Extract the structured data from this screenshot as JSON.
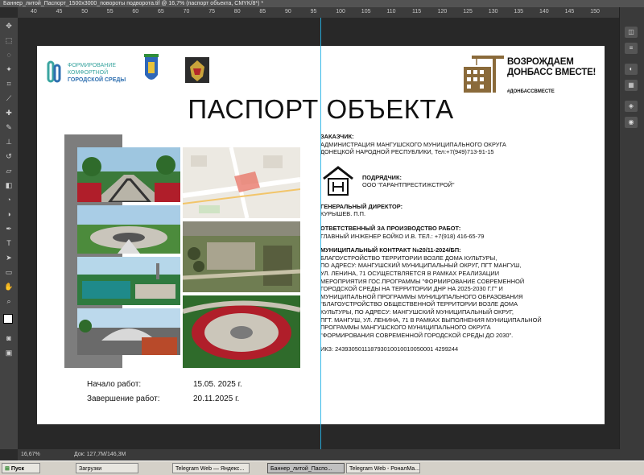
{
  "window": {
    "title": "Баннер_литой_Паспорт_1500х3000_повороты подворота.tif @ 16,7% (паспорт объекта, CMYK/8*) *"
  },
  "ruler": {
    "ticks": [
      "40",
      "45",
      "50",
      "55",
      "60",
      "65",
      "70",
      "75",
      "80",
      "85",
      "90",
      "95",
      "100",
      "105",
      "110",
      "115",
      "120",
      "125",
      "130",
      "135",
      "140",
      "145",
      "150"
    ]
  },
  "status": {
    "zoom": "16,67%",
    "doc": "Док: 127,7M/146,3M"
  },
  "taskbar": {
    "start": "Пуск",
    "tasks": [
      "Загрузки",
      "Telegram Web — Яндекс...",
      "Баннер_литой_Паспо...",
      "Telegram Web - РоналМа..."
    ]
  },
  "doc": {
    "fks_logo": {
      "line1": "ФОРМИРОВАНИЕ",
      "line2": "КОМФОРТНОЙ",
      "line3": "ГОРОДСКОЙ СРЕДЫ"
    },
    "banner": {
      "line1": "ВОЗРОЖДАЕМ",
      "line2": "ДОНБАСС ВМЕСТЕ!",
      "hashtag": "#ДОНБАССВМЕСТЕ"
    },
    "title": "ПАСПОРТ ОБЪЕКТА",
    "customer": {
      "heading": "ЗАКАЗЧИК:",
      "line1": "АДМИНИСТРАЦИЯ МАНГУШСКОГО МУНИЦИПАЛЬНОГО ОКРУГА",
      "line2": "ДОНЕЦКОЙ НАРОДНОЙ РЕСПУБЛИКИ, Тел:+7(949)713-91-15"
    },
    "contractor": {
      "heading": "ПОДРЯДЧИК:",
      "name": "ООО \"ГАРАНТПРЕСТИЖСТРОЙ\""
    },
    "director": {
      "heading": "ГЕНЕРАЛЬНЫЙ ДИРЕКТОР:",
      "name": "КУРЫШЕВ. П.П."
    },
    "responsible": {
      "heading": "ОТВЕТСТВЕННЫЙ ЗА ПРОИЗВОДСТВО РАБОТ:",
      "name": "ГЛАВНЫЙ ИНЖЕНЕР БОЙКО И.В. ТЕЛ.: +7(918) 416-65-79"
    },
    "contract": {
      "heading": "МУНИЦИПАЛЬНЫЙ КОНТРАКТ №20/11-2024/БП:",
      "lines": [
        "БЛАГОУСТРОЙСТВО ТЕРРИТОРИИ ВОЗЛЕ ДОМА КУЛЬТУРЫ,",
        "ПО АДРЕСУ: МАНГУШСКИЙ МУНИЦИПАЛЬНЫЙ ОКРУГ, ПГТ МАНГУШ,",
        "УЛ. ЛЕНИНА, 71 ОСУЩЕСТВЛЯЕТСЯ В РАМКАХ РЕАЛИЗАЦИИ",
        "МЕРОПРИЯТИЯ ГОС.ПРОГРАММЫ \"ФОРМИРОВАНИЕ СОВРЕМЕННОЙ",
        "ГОРОДСКОЙ СРЕДЫ НА ТЕРРИТОРИИ ДНР НА 2025-2030 Г.Г\" И",
        "МУНИЦИПАЛЬНОЙ ПРОГРАММЫ МУНИЦИПАЛЬНОГО ОБРАЗОВАНИЯ",
        "\"БЛАГОУСТРОЙСТВО ОБЩЕСТВЕННОЙ ТЕРРИТОРИИ ВОЗЛЕ ДОМА",
        "КУЛЬТУРЫ, ПО АДРЕСУ: МАНГУШСКИЙ МУНИЦИПАЛЬНЫЙ ОКРУГ,",
        "ПГТ. МАНГУШ, УЛ. ЛЕНИНА, 71 В РАМКАХ ВЫПОЛНЕНИЯ МУНИЦИПАЛЬНОЙ",
        "ПРОГРАММЫ МАНГУШСКОГО МУНИЦИПАЛЬНОГО ОКРУГА",
        "\"ФОРМИРОВАНИЯ СОВРЕМЕННОЙ ГОРОДСКОЙ СРЕДЫ ДО 2030\"."
      ]
    },
    "ikz": "ИКЗ: 243930501118793010010010050001 4299244",
    "start_label": "Начало работ:",
    "start_date": "15.05. 2025 г.",
    "end_label": "Завершение работ:",
    "end_date": "20.11.2025 г."
  },
  "colors": {
    "guide": "#27b3e6",
    "banner_brown": "#8a6a3a",
    "fks_teal": "#3aa5a0",
    "fks_blue": "#2e6fb0"
  }
}
